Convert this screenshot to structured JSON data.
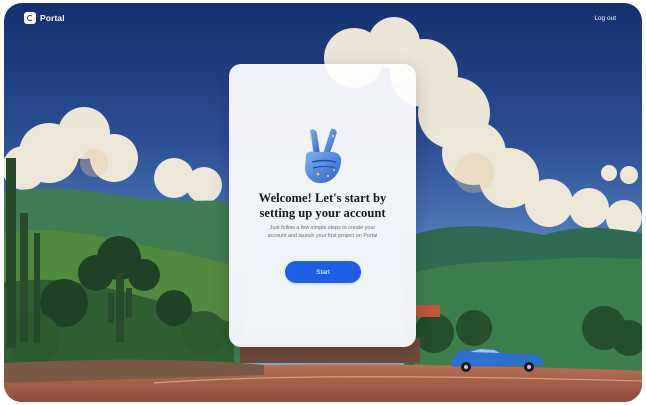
{
  "header": {
    "brand_name": "Portal",
    "logout_label": "Log out"
  },
  "card": {
    "illustration_icon": "peace-hand-icon",
    "title_line1": "Welcome! Let's start by",
    "title_line2": "setting up your account",
    "subtitle": "Just follow a few simple steps to create your account and launch your first project on Portal",
    "start_label": "Start"
  },
  "colors": {
    "accent": "#1f5fe6",
    "sky": "#1f3c7a"
  }
}
